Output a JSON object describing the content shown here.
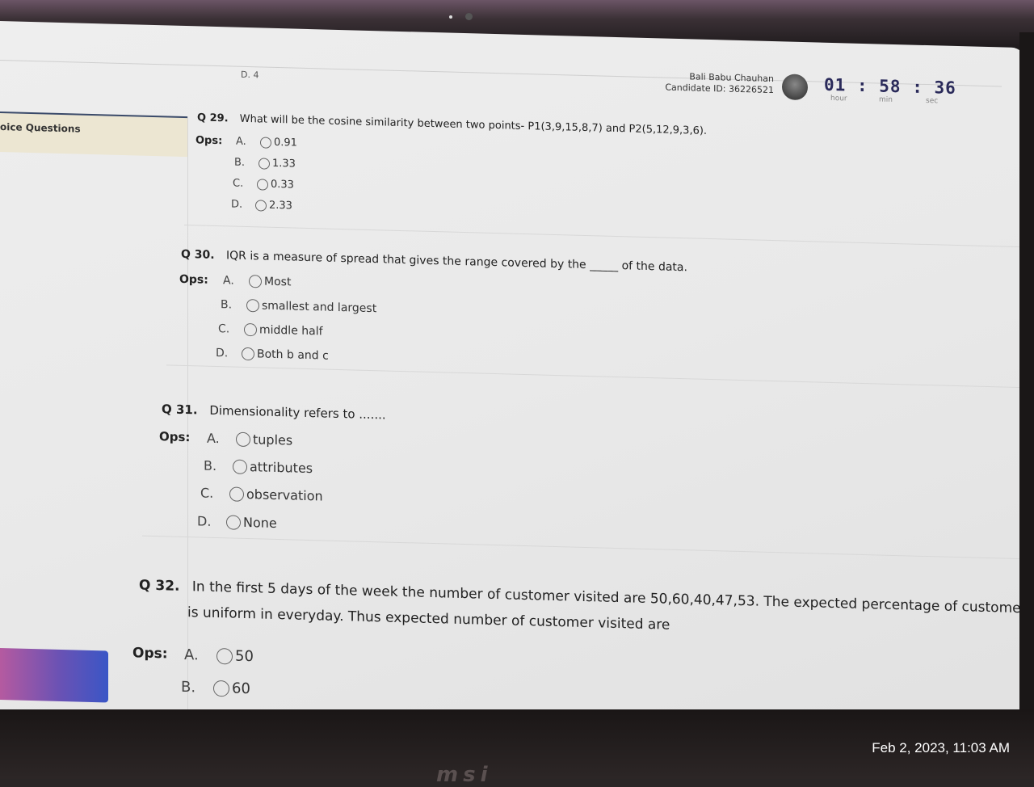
{
  "header": {
    "candidate_name": "Bali Babu Chauhan",
    "candidate_id": "Candidate ID: 36226521",
    "timer": {
      "hour": "01",
      "min": "58",
      "sec": "36",
      "sep": ":",
      "hour_label": "hour",
      "min_label": "min",
      "sec_label": "sec"
    },
    "cutoff_prev": "D.  4"
  },
  "sidebar": {
    "section_label": "oice Questions"
  },
  "questions": [
    {
      "num": "Q 29.",
      "text": "What will be the cosine similarity between two points- P1(3,9,15,8,7) and P2(5,12,9,3,6).",
      "ops_label": "Ops:",
      "options": [
        {
          "letter": "A.",
          "text": "0.91"
        },
        {
          "letter": "B.",
          "text": "1.33"
        },
        {
          "letter": "C.",
          "text": "0.33"
        },
        {
          "letter": "D.",
          "text": "2.33"
        }
      ]
    },
    {
      "num": "Q 30.",
      "text": "IQR is a measure of spread that gives the range covered by the _____ of the data.",
      "ops_label": "Ops:",
      "options": [
        {
          "letter": "A.",
          "text": "Most"
        },
        {
          "letter": "B.",
          "text": "smallest and largest"
        },
        {
          "letter": "C.",
          "text": "middle half"
        },
        {
          "letter": "D.",
          "text": "Both b and c"
        }
      ]
    },
    {
      "num": "Q 31.",
      "text": "Dimensionality refers to .......",
      "ops_label": "Ops:",
      "options": [
        {
          "letter": "A.",
          "text": "tuples"
        },
        {
          "letter": "B.",
          "text": "attributes"
        },
        {
          "letter": "C.",
          "text": "observation"
        },
        {
          "letter": "D.",
          "text": "None"
        }
      ]
    },
    {
      "num": "Q 32.",
      "text_line1": "In the first 5 days of the week the number of customer visited are 50,60,40,47,53. The expected percentage of customer to visit th",
      "text_line2": "is uniform in everyday. Thus expected number of customer visited are",
      "ops_label": "Ops:",
      "options": [
        {
          "letter": "A.",
          "text": "50"
        },
        {
          "letter": "B.",
          "text": "60"
        }
      ]
    }
  ],
  "overlay": {
    "timestamp": "Feb 2, 2023, 11:03 AM",
    "brand_logo": "msi"
  }
}
